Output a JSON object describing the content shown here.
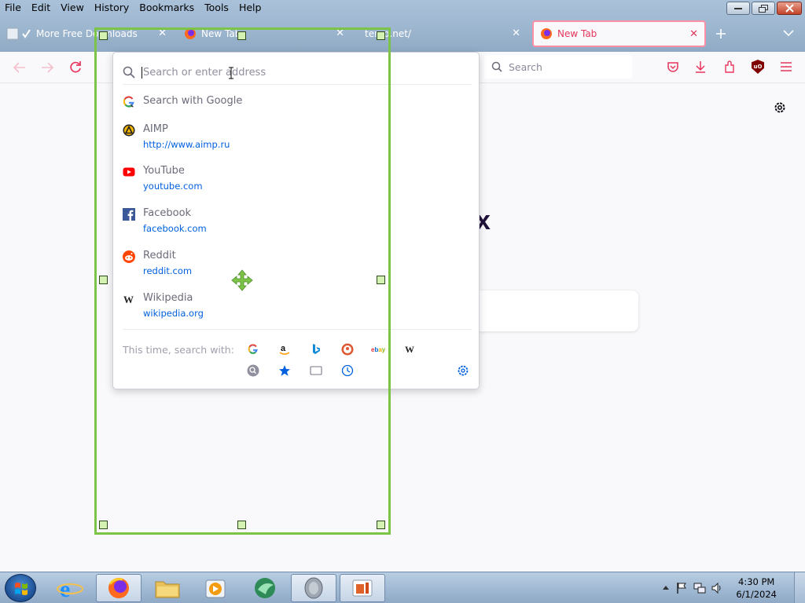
{
  "menubar": {
    "items": [
      "File",
      "Edit",
      "View",
      "History",
      "Bookmarks",
      "Tools",
      "Help"
    ]
  },
  "tabs": [
    {
      "label": "More Free Downloads",
      "active": false,
      "icon": "checkmark-page-icon"
    },
    {
      "label": "New Tab",
      "active": false,
      "icon": "firefox-icon"
    },
    {
      "label": "temp.net/",
      "active": false,
      "icon": "page-icon"
    },
    {
      "label": "New Tab",
      "active": true,
      "icon": "firefox-icon"
    }
  ],
  "navbar": {
    "search_placeholder": "Search"
  },
  "urlbar": {
    "placeholder": "Search or enter address"
  },
  "results": [
    {
      "title": "Search with Google",
      "url": "",
      "icon": "google-icon"
    },
    {
      "title": "AIMP",
      "url": "http://www.aimp.ru",
      "icon": "aimp-icon"
    },
    {
      "title": "YouTube",
      "url": "youtube.com",
      "icon": "youtube-icon"
    },
    {
      "title": "Facebook",
      "url": "facebook.com",
      "icon": "facebook-icon"
    },
    {
      "title": "Reddit",
      "url": "reddit.com",
      "icon": "reddit-icon"
    },
    {
      "title": "Wikipedia",
      "url": "wikipedia.org",
      "icon": "wikipedia-icon"
    }
  ],
  "oneoff": {
    "label": "This time, search with:",
    "engines": [
      "google",
      "amazon",
      "bing",
      "duckduckgo",
      "ebay",
      "wikipedia"
    ],
    "modes": [
      "search-icon",
      "bookmarks-star-icon",
      "tabs-icon",
      "history-clock-icon"
    ]
  },
  "content": {
    "brand_letter": "x"
  },
  "taskbar": {
    "apps": [
      "internet-explorer",
      "firefox",
      "file-explorer",
      "media-player",
      "app-bird",
      "speaker-app",
      "office-app"
    ],
    "time": "4:30 PM",
    "date": "6/1/2024"
  },
  "colors": {
    "accent_pink": "#e8365d",
    "selection_green": "#7cc448",
    "link_blue": "#0060df"
  }
}
